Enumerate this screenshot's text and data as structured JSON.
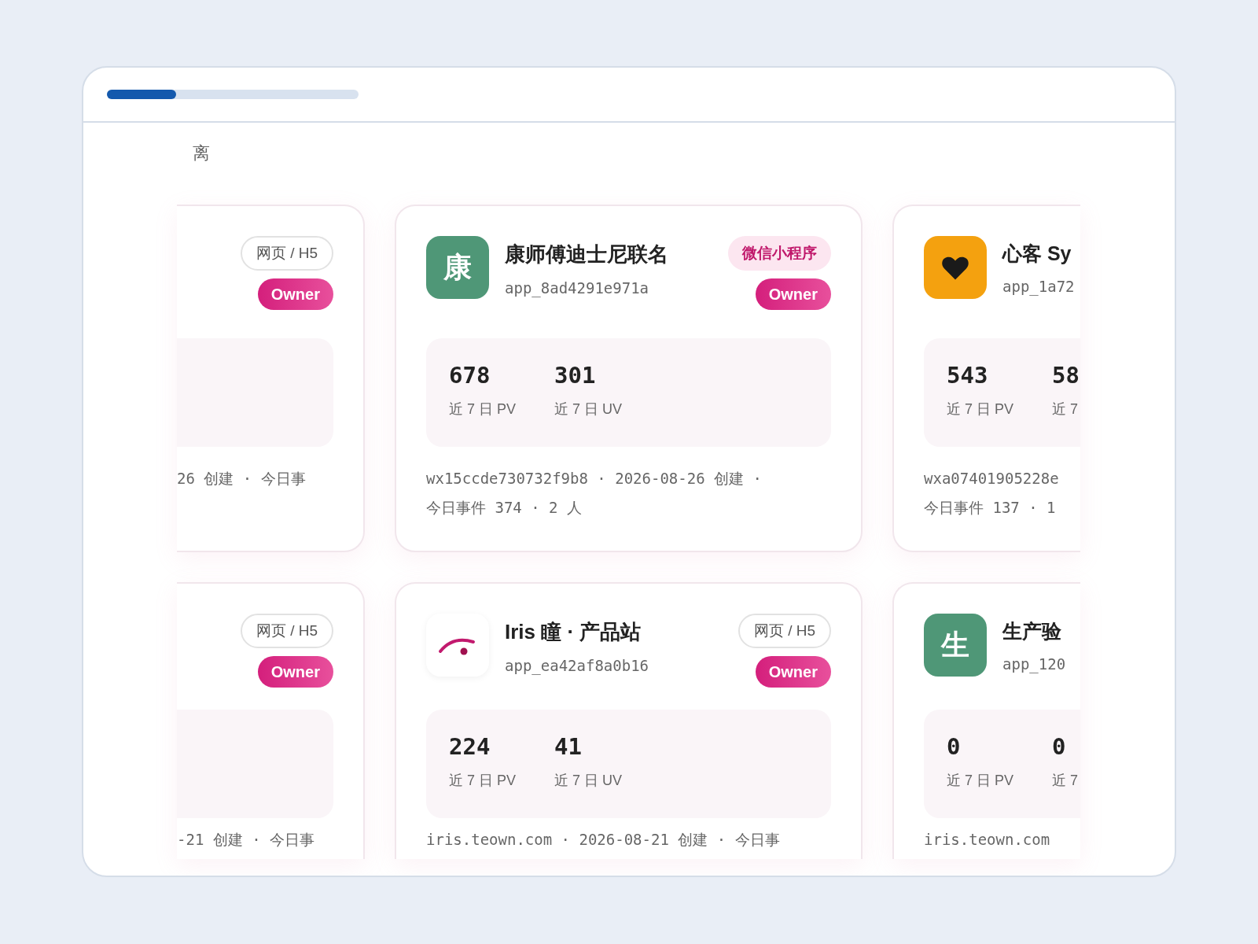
{
  "progress": {
    "level": 0.275
  },
  "section_label": "离",
  "rows": [
    {
      "cards": [
        {
          "kind": "left_partial",
          "type_tag": {
            "kind": "web",
            "label": "网页 / H5"
          },
          "role": "Owner",
          "footer_lines": [
            "26 创建 · 今日事"
          ]
        },
        {
          "kind": "full",
          "icon": {
            "kind": "letter",
            "text": "康",
            "color": "#4f9777"
          },
          "title": "康师傅迪士尼联名",
          "app_id": "app_8ad4291e971a",
          "type_tag": {
            "kind": "wechat",
            "label": "微信小程序"
          },
          "role": "Owner",
          "stats": [
            {
              "value": "678",
              "label": "近 7 日 PV"
            },
            {
              "value": "301",
              "label": "近 7 日 UV"
            }
          ],
          "footer_lines": [
            "wx15ccde730732f9b8 · 2026-08-26 创建 ·",
            "今日事件 374 · 2 人"
          ]
        },
        {
          "kind": "right_partial",
          "icon": {
            "kind": "heart",
            "color": "#f4a10f"
          },
          "title": "心客 Sy",
          "app_id": "app_1a72",
          "stats": [
            {
              "value": "543",
              "label": "近 7 日 PV"
            },
            {
              "value": "58",
              "label": "近 7"
            }
          ],
          "footer_lines": [
            "wxa07401905228e",
            "今日事件 137 · 1"
          ]
        }
      ]
    },
    {
      "cards": [
        {
          "kind": "left_partial",
          "type_tag": {
            "kind": "web",
            "label": "网页 / H5"
          },
          "role": "Owner",
          "footer_lines": [
            "-21 创建 · 今日事"
          ]
        },
        {
          "kind": "full",
          "icon": {
            "kind": "arc",
            "color": "#ffffff"
          },
          "title": "Iris 瞳 · 产品站",
          "app_id": "app_ea42af8a0b16",
          "type_tag": {
            "kind": "web",
            "label": "网页 / H5"
          },
          "role": "Owner",
          "stats": [
            {
              "value": "224",
              "label": "近 7 日 PV"
            },
            {
              "value": "41",
              "label": "近 7 日 UV"
            }
          ],
          "footer_lines": [
            "iris.teown.com · 2026-08-21 创建 · 今日事"
          ]
        },
        {
          "kind": "right_partial",
          "icon": {
            "kind": "letter",
            "text": "生",
            "color": "#4f9777"
          },
          "title": "生产验",
          "app_id": "app_120",
          "stats": [
            {
              "value": "0",
              "label": "近 7 日 PV"
            },
            {
              "value": "0",
              "label": "近 7"
            }
          ],
          "footer_lines": [
            "iris.teown.com"
          ]
        }
      ]
    }
  ]
}
